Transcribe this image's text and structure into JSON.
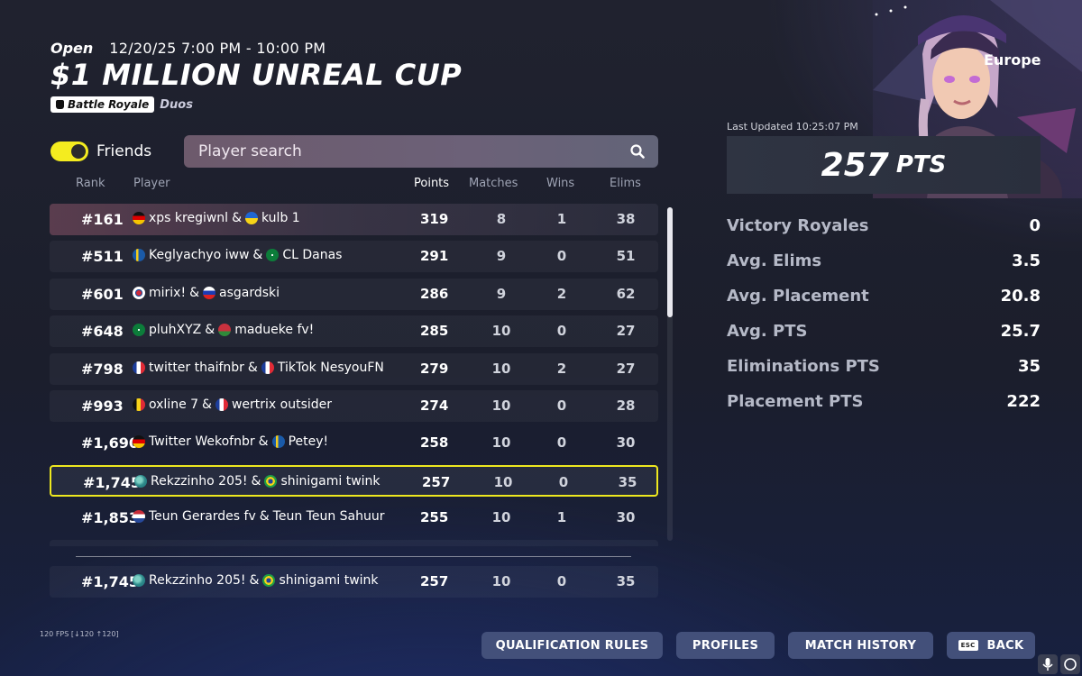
{
  "event": {
    "status": "Open",
    "datetime": "12/20/25 7:00 PM - 10:00 PM",
    "title": "$1 MILLION UNREAL CUP",
    "mode": "Battle Royale",
    "team_size": "Duos"
  },
  "controls": {
    "friends_label": "Friends",
    "friends_on": true,
    "search_placeholder": "Player search"
  },
  "columns": {
    "rank": "Rank",
    "player": "Player",
    "points": "Points",
    "matches": "Matches",
    "wins": "Wins",
    "elims": "Elims"
  },
  "leaderboard": [
    {
      "rank": "#161",
      "p1": "xps kregiwnl",
      "f1": "germany",
      "p2": "kulb 1",
      "f2": "ukraine",
      "points": "319",
      "matches": "8",
      "wins": "1",
      "elims": "38"
    },
    {
      "rank": "#511",
      "p1": "Keglyachyo iww",
      "f1": "sweden",
      "p2": "CL Danas",
      "f2": "saudi",
      "points": "291",
      "matches": "9",
      "wins": "0",
      "elims": "51"
    },
    {
      "rank": "#601",
      "p1": "mirix!",
      "f1": "south-korea",
      "p2": "asgardski",
      "f2": "russia",
      "points": "286",
      "matches": "9",
      "wins": "2",
      "elims": "62"
    },
    {
      "rank": "#648",
      "p1": "pluhXYZ",
      "f1": "saudi",
      "p2": "madueke fv!",
      "f2": "belarus",
      "points": "285",
      "matches": "10",
      "wins": "0",
      "elims": "27"
    },
    {
      "rank": "#798",
      "p1": "twitter thaifnbr",
      "f1": "france",
      "p2": "TikTok NesyouFN",
      "f2": "france",
      "points": "279",
      "matches": "10",
      "wins": "2",
      "elims": "27"
    },
    {
      "rank": "#993",
      "p1": "oxline 7",
      "f1": "belgium",
      "p2": "wertrix outsider",
      "f2": "france",
      "points": "274",
      "matches": "10",
      "wins": "0",
      "elims": "28"
    },
    {
      "rank": "#1,690",
      "p1": "Twitter Wekofnbr",
      "f1": "germany",
      "p2": "Petey!",
      "f2": "sweden",
      "points": "258",
      "matches": "10",
      "wins": "0",
      "elims": "30"
    },
    {
      "rank": "#1,745",
      "p1": "Rekzzinho 205!",
      "f1": "world",
      "p2": "shinigami twink",
      "f2": "brazil",
      "points": "257",
      "matches": "10",
      "wins": "0",
      "elims": "35"
    },
    {
      "rank": "#1,853",
      "p1": "Teun Gerardes fv",
      "f1": "netherlands",
      "p2": "Teun Teun Sahuur",
      "f2": "",
      "points": "255",
      "matches": "10",
      "wins": "1",
      "elims": "30"
    }
  ],
  "my_team": {
    "rank": "#1,745",
    "p1": "Rekzzinho 205!",
    "f1": "world",
    "p2": "shinigami twink",
    "f2": "brazil",
    "points": "257",
    "matches": "10",
    "wins": "0",
    "elims": "35"
  },
  "summary": {
    "region": "Europe",
    "last_updated": "Last Updated 10:25:07 PM",
    "total_points": "257",
    "points_unit": "PTS",
    "stats": [
      {
        "label": "Victory Royales",
        "value": "0"
      },
      {
        "label": "Avg. Elims",
        "value": "3.5"
      },
      {
        "label": "Avg. Placement",
        "value": "20.8"
      },
      {
        "label": "Avg. PTS",
        "value": "25.7"
      },
      {
        "label": "Eliminations PTS",
        "value": "35"
      },
      {
        "label": "Placement PTS",
        "value": "222"
      }
    ]
  },
  "fps_label": "120 FPS [↓120 ↑120]",
  "buttons": {
    "qualification": "QUALIFICATION RULES",
    "profiles": "PROFILES",
    "match_history": "MATCH HISTORY",
    "esc_key": "ESC",
    "back": "BACK"
  },
  "colors": {
    "highlight": "#eee81f",
    "button": "#43507a"
  }
}
